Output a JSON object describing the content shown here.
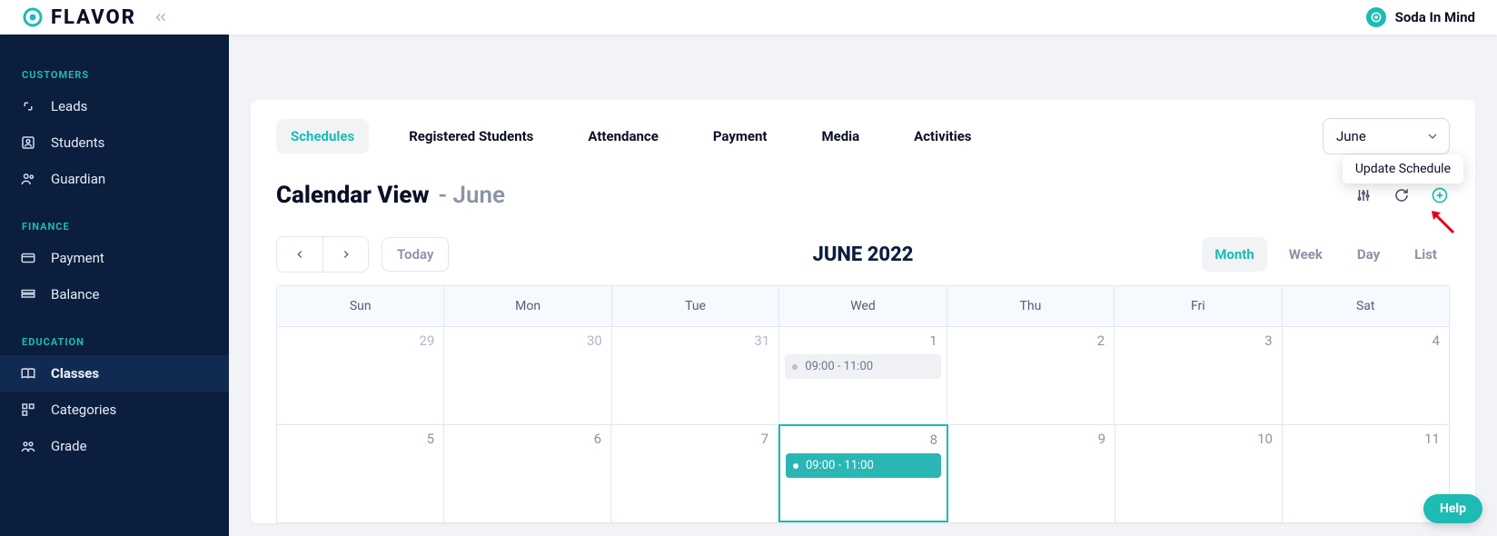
{
  "brand": {
    "text": "FLAVOR"
  },
  "topbar": {
    "company": "Soda In Mind"
  },
  "sidebar": {
    "sections": [
      {
        "title": "CUSTOMERS",
        "items": [
          {
            "label": "Leads"
          },
          {
            "label": "Students"
          },
          {
            "label": "Guardian"
          }
        ]
      },
      {
        "title": "FINANCE",
        "items": [
          {
            "label": "Payment"
          },
          {
            "label": "Balance"
          }
        ]
      },
      {
        "title": "EDUCATION",
        "items": [
          {
            "label": "Classes"
          },
          {
            "label": "Categories"
          },
          {
            "label": "Grade"
          }
        ]
      }
    ]
  },
  "tabs": {
    "items": [
      {
        "label": "Schedules"
      },
      {
        "label": "Registered Students"
      },
      {
        "label": "Attendance"
      },
      {
        "label": "Payment"
      },
      {
        "label": "Media"
      },
      {
        "label": "Activities"
      }
    ],
    "month_select": "June"
  },
  "calendar": {
    "title": "Calendar View",
    "subtitle": " - June",
    "tooltip": "Update Schedule",
    "today_label": "Today",
    "period_title": "JUNE 2022",
    "views": [
      "Month",
      "Week",
      "Day",
      "List"
    ],
    "weekday_headers": [
      "Sun",
      "Mon",
      "Tue",
      "Wed",
      "Thu",
      "Fri",
      "Sat"
    ],
    "weeks": [
      {
        "days": [
          {
            "n": "29",
            "other": true
          },
          {
            "n": "30",
            "other": true
          },
          {
            "n": "31",
            "other": true
          },
          {
            "n": "1",
            "event": {
              "label": "09:00 - 11:00",
              "kind": "past"
            }
          },
          {
            "n": "2"
          },
          {
            "n": "3"
          },
          {
            "n": "4"
          }
        ]
      },
      {
        "days": [
          {
            "n": "5"
          },
          {
            "n": "6"
          },
          {
            "n": "7"
          },
          {
            "n": "8",
            "today": true,
            "event": {
              "label": "09:00 - 11:00",
              "kind": "active"
            }
          },
          {
            "n": "9"
          },
          {
            "n": "10"
          },
          {
            "n": "11"
          }
        ]
      }
    ]
  },
  "help": "Help"
}
